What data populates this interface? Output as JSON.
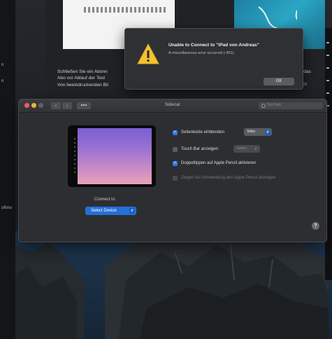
{
  "sidebar_left": {
    "snippet1": "n",
    "snippet2": "n",
    "snippet3": "ufonu"
  },
  "background_page": {
    "lines": [
      "Schließen Sie ein Abonn",
      "Abo vor Ablauf der Test",
      "Von beeindruckenden Bil"
    ],
    "tail1": "on das",
    "tail2": "n: Mi"
  },
  "alert": {
    "title": "Unable to Connect to \"iPad von Andreas\"",
    "message": "A miscellaneous error occurred (-401).",
    "ok_label": "OK",
    "icon": "warning-triangle-icon"
  },
  "sidecar": {
    "window_title": "Sidecar",
    "search_placeholder": "Suchen",
    "back_glyph": "‹",
    "forward_glyph": "›",
    "options": {
      "sidebar_label": "Seitenleiste einblenden",
      "sidebar_position": "links",
      "sidebar_checked": true,
      "touchbar_label": "Touch Bar anzeigen",
      "touchbar_position": "unten",
      "touchbar_checked": false,
      "doubletap_label": "Doppeltippen auf Apple Pencil aktivieren",
      "doubletap_checked": true,
      "pencil_label": "Zeigen bei Verwendung des Apple Pencil anzeigen",
      "pencil_checked": true
    },
    "connect_to_label": "Connect to:",
    "device_select": "Select Device",
    "help_glyph": "?"
  },
  "colors": {
    "accent": "#2f7bea",
    "alert_bg": "#2f3033",
    "window_bg": "#2d2e31"
  }
}
